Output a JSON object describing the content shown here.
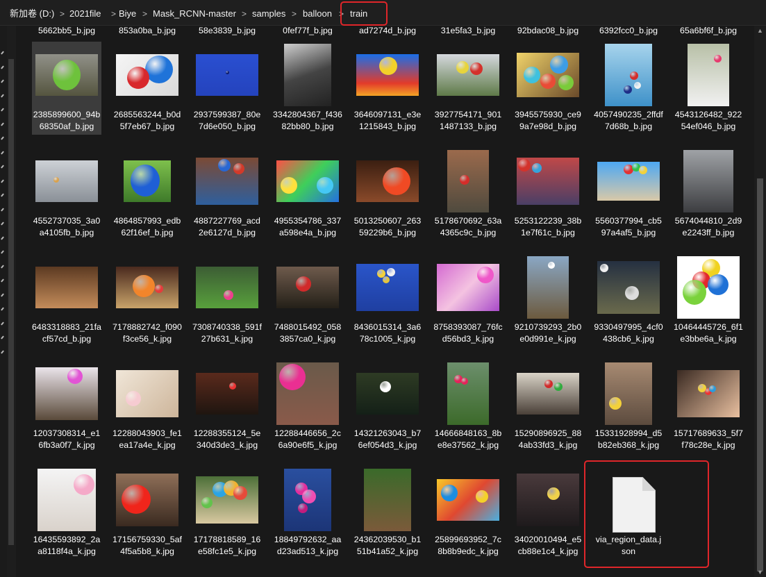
{
  "breadcrumb": [
    "新加卷 (D:)",
    "2021file",
    "Biye",
    "Mask_RCNN-master",
    "samples",
    "balloon",
    "train"
  ],
  "breadcrumb_separator": ">",
  "annotation_color": "#e0262a",
  "top_row_labels": [
    "5662bb5_b.jpg",
    "853a0ba_b.jpg",
    "58e3839_b.jpg",
    "0fef77f_b.jpg",
    "ad7274d_b.jpg",
    "31e5fa3_b.jpg",
    "92bdac08_b.jpg",
    "6392fcc0_b.jpg",
    "65a6bf6f_b.jpg"
  ],
  "files": [
    {
      "name": "2385899600_94b68350af_b.jpg",
      "selected": true,
      "icon": "green-balloon-face-photo"
    },
    {
      "name": "2685563244_b0d5f7eb67_b.jpg",
      "icon": "red-blue-balloons-photo"
    },
    {
      "name": "2937599387_80e7d6e050_b.jpg",
      "icon": "blue-sky-balloon-photo"
    },
    {
      "name": "3342804367_f43682bb80_b.jpg",
      "icon": "bw-bridge-balloon-photo"
    },
    {
      "name": "3646097131_e3e1215843_b.jpg",
      "icon": "smiley-balloon-photo"
    },
    {
      "name": "3927754171_9011487133_b.jpg",
      "icon": "party-balloons-photo"
    },
    {
      "name": "3945575930_ce99a7e98d_b.jpg",
      "icon": "colorful-balloons-photo"
    },
    {
      "name": "4057490235_2ffdf7d68b_b.jpg",
      "icon": "sky-balloons-photo"
    },
    {
      "name": "4543126482_92254ef046_b.jpg",
      "icon": "woman-balloon-photo"
    },
    {
      "name": "4552737035_3a0a4105fb_b.jpg",
      "icon": "cloudy-sky-balloon-photo"
    },
    {
      "name": "4864857993_edb62f16ef_b.jpg",
      "icon": "blue-balloon-photo"
    },
    {
      "name": "4887227769_acd2e6127d_b.jpg",
      "icon": "people-balloons-photo"
    },
    {
      "name": "4955354786_337a598e4a_b.jpg",
      "icon": "dog-balloons-photo"
    },
    {
      "name": "5013250607_26359229b6_b.jpg",
      "icon": "red-balloon-closeup-photo"
    },
    {
      "name": "5178670692_63a4365c9c_b.jpg",
      "icon": "wall-balloon-photo"
    },
    {
      "name": "5253122239_38b1e7f61c_b.jpg",
      "icon": "crowd-balloons-photo"
    },
    {
      "name": "5560377994_cb597a4af5_b.jpg",
      "icon": "beach-balloons-photo"
    },
    {
      "name": "5674044810_2d9e2243ff_b.jpg",
      "icon": "street-balloons-photo"
    },
    {
      "name": "6483318883_21facf57cd_b.jpg",
      "icon": "room-balloons-photo"
    },
    {
      "name": "7178882742_f090f3ce56_k.jpg",
      "icon": "orange-balloon-photo"
    },
    {
      "name": "7308740338_591f27b631_k.jpg",
      "icon": "grass-balloon-photo"
    },
    {
      "name": "7488015492_0583857ca0_k.jpg",
      "icon": "brick-house-balloon-photo"
    },
    {
      "name": "8436015314_3a678c1005_k.jpg",
      "icon": "sky-balloon-bunch-photo"
    },
    {
      "name": "8758393087_76fcd56bd3_k.jpg",
      "icon": "girl-balloons-photo"
    },
    {
      "name": "9210739293_2b0e0d991e_k.jpg",
      "icon": "stilts-balloons-photo"
    },
    {
      "name": "9330497995_4cf0438cb6_k.jpg",
      "icon": "balloon-animals-photo"
    },
    {
      "name": "10464445726_6f1e3bbe6a_k.jpg",
      "icon": "white-bg-balloons-photo"
    },
    {
      "name": "12037308314_e16fb3a0f7_k.jpg",
      "icon": "family-balloon-photo"
    },
    {
      "name": "12288043903_fe1ea17a4e_k.jpg",
      "icon": "dancer-balloons-photo"
    },
    {
      "name": "12288355124_5e340d3de3_k.jpg",
      "icon": "room-window-balloons-photo"
    },
    {
      "name": "12288446656_2c6a90e6f5_k.jpg",
      "icon": "pink-balloon-girl-photo"
    },
    {
      "name": "14321263043_b76ef054d3_k.jpg",
      "icon": "girl-sitting-balloons-photo"
    },
    {
      "name": "14666848163_8be8e37562_k.jpg",
      "icon": "bench-balloons-photo"
    },
    {
      "name": "15290896925_884ab33fd3_k.jpg",
      "icon": "parade-balloons-photo"
    },
    {
      "name": "15331928994_d5b82eb368_k.jpg",
      "icon": "toddler-balloon-photo"
    },
    {
      "name": "15717689633_5f7f78c28e_k.jpg",
      "icon": "window-balloons-photo"
    },
    {
      "name": "16435593892_2aa8118f4a_k.jpg",
      "icon": "girl-pink-balloon-photo"
    },
    {
      "name": "17156759330_5af4f5a5b8_k.jpg",
      "icon": "red-balloon-table-photo"
    },
    {
      "name": "17178818589_16e58fc1e5_k.jpg",
      "icon": "window-colorful-balloons-photo"
    },
    {
      "name": "18849792632_aad23ad513_k.jpg",
      "icon": "pink-balloon-bunch-photo"
    },
    {
      "name": "24362039530_b151b41a52_k.jpg",
      "icon": "truck-balloons-photo"
    },
    {
      "name": "25899693952_7c8b8b9edc_k.jpg",
      "icon": "decorations-balloons-photo"
    },
    {
      "name": "34020010494_e5cb88e1c4_k.jpg",
      "icon": "costume-balloons-photo"
    },
    {
      "name": "via_region_data.json",
      "icon": "json-file-icon"
    }
  ]
}
